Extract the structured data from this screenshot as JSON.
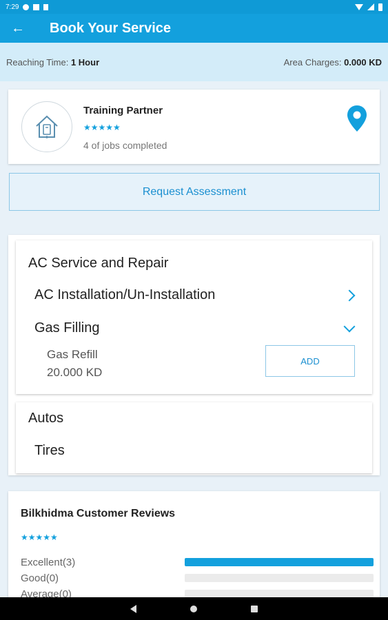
{
  "status_bar": {
    "time": "7:29"
  },
  "app_bar": {
    "back_icon": "arrow-left-icon",
    "title": "Book Your Service"
  },
  "info_bar": {
    "reaching_label": "Reaching Time:",
    "reaching_value": "1 Hour",
    "area_label": "Area Charges:",
    "area_value": "0.000 KD"
  },
  "partner": {
    "name": "Training Partner",
    "stars": "★★★★★",
    "jobs": "4 of jobs completed",
    "location_icon": "map-pin-icon"
  },
  "request_assessment_label": "Request Assessment",
  "categories": [
    {
      "title": "AC Service and Repair",
      "subcategories": [
        {
          "label": "AC Installation/Un-Installation",
          "icon": "chevron-right-icon"
        },
        {
          "label": "Gas Filling",
          "icon": "chevron-down-icon"
        }
      ],
      "item": {
        "name": "Gas Refill",
        "price": "20.000 KD",
        "add_label": "ADD"
      }
    },
    {
      "title": "Autos",
      "subcategories": [
        {
          "label": "Tires"
        }
      ]
    }
  ],
  "reviews": {
    "title": "Bilkhidma Customer Reviews",
    "stars": "★★★★★",
    "ratings": [
      {
        "label": "Excellent(3)",
        "fraction": 1.0
      },
      {
        "label": "Good(0)",
        "fraction": 0
      },
      {
        "label": "Average(0)",
        "fraction": 0
      }
    ]
  },
  "colors": {
    "primary": "#13a0dd",
    "info_bar": "#d3ecf9",
    "background": "#e8f1f8"
  }
}
